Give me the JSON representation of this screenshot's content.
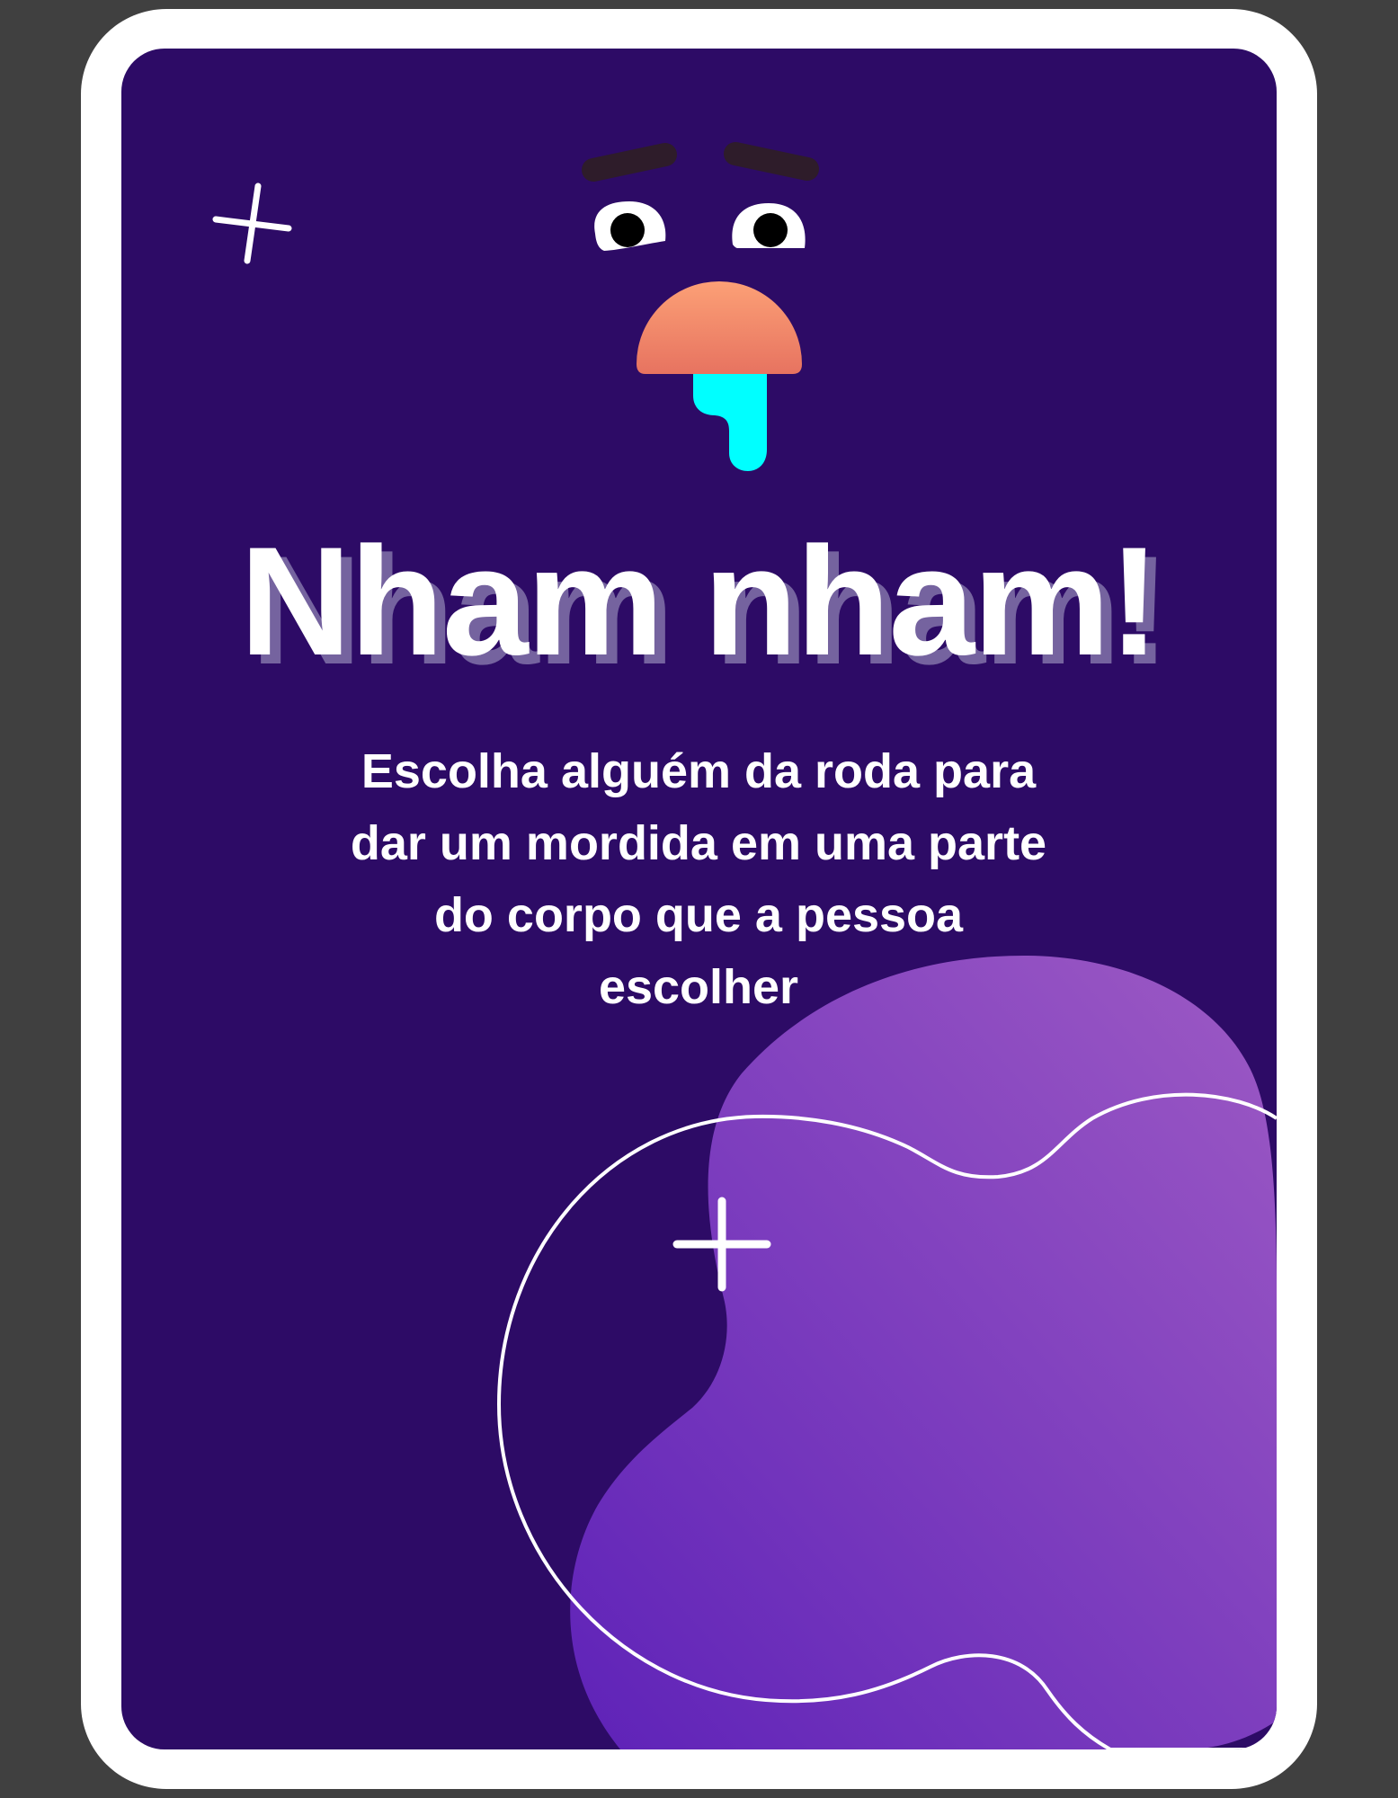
{
  "card": {
    "title": "Nham nham!",
    "instruction": "Escolha alguém da roda para dar um mordida em uma parte do corpo que a pessoa escolher"
  },
  "colors": {
    "page_background": "#404040",
    "card_border": "#ffffff",
    "card_background": "#2d0b66",
    "title_shadow": "#75639f",
    "blob_gradient_start": "#5e22b8",
    "blob_gradient_end": "#9d5ac4",
    "mouth_gradient_top": "#fca076",
    "mouth_gradient_bottom": "#e77360",
    "drool": "#00ffff",
    "eyebrow": "#2e1c2a"
  },
  "icons": [
    "face-illustration",
    "sparkle-cross-icon",
    "decorative-blob",
    "outline-ring"
  ]
}
